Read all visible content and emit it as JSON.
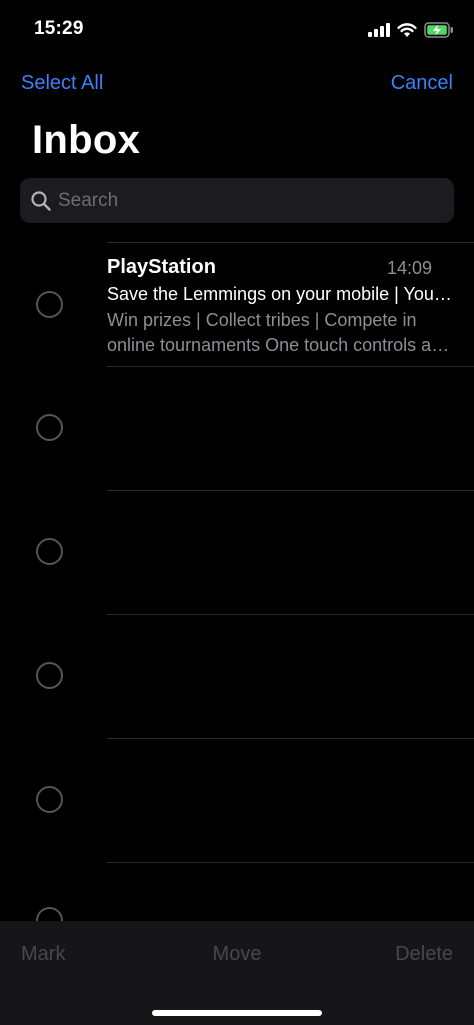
{
  "status_bar": {
    "time": "15:29"
  },
  "nav": {
    "select_all": "Select All",
    "cancel": "Cancel"
  },
  "title": "Inbox",
  "search": {
    "placeholder": "Search"
  },
  "emails": [
    {
      "sender": "PlayStation",
      "time": "14:09",
      "subject": "Save the Lemmings on your mobile | Your free game awaits",
      "preview": "Win prizes | Collect tribes | Compete in online tournaments One touch controls and endless fun"
    }
  ],
  "toolbar": {
    "mark": "Mark",
    "move": "Move",
    "delete": "Delete"
  },
  "colors": {
    "accent": "#3a82f7",
    "background": "#000000",
    "secondary_text": "#8e8e93",
    "battery": "#4cd964"
  },
  "icons": {
    "signal": "cellular-signal-icon",
    "wifi": "wifi-icon",
    "battery": "battery-charging-icon",
    "search": "search-icon",
    "checkbox": "selection-circle-icon"
  }
}
